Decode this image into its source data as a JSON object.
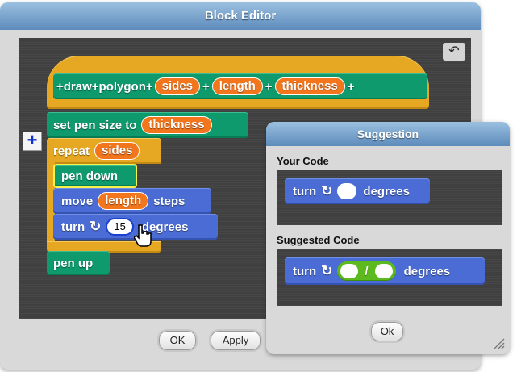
{
  "block_editor": {
    "title": "Block Editor",
    "ok_label": "OK",
    "apply_label": "Apply",
    "undo_symbol": "↶",
    "add_symbol": "+",
    "header_block": {
      "words": [
        "draw",
        "polygon"
      ],
      "params": [
        "sides",
        "length",
        "thickness"
      ]
    },
    "script": {
      "set_pen_size": {
        "text": "set pen size to",
        "arg": "thickness"
      },
      "repeat": {
        "text": "repeat",
        "arg": "sides"
      },
      "pen_down": "pen down",
      "move": {
        "text": "move",
        "arg": "length",
        "suffix": "steps"
      },
      "turn": {
        "text": "turn",
        "arg": "15",
        "suffix": "degrees"
      },
      "pen_up": "pen up"
    }
  },
  "suggestion": {
    "title": "Suggestion",
    "your_code_label": "Your Code",
    "suggested_code_label": "Suggested Code",
    "your_block": {
      "text": "turn",
      "suffix": "degrees"
    },
    "suggested_block": {
      "text": "turn",
      "divider": "/",
      "suffix": "degrees"
    },
    "ok_label": "Ok"
  },
  "icons": {
    "turn_icon": "↻",
    "cursor": "hand-pointer"
  },
  "colors": {
    "motion": "#4a6cd4",
    "pen": "#0e9a6c",
    "control": "#e6a822",
    "variable": "#f3761d",
    "operator": "#5cba1f",
    "title_blue": "#5d8bbb"
  }
}
